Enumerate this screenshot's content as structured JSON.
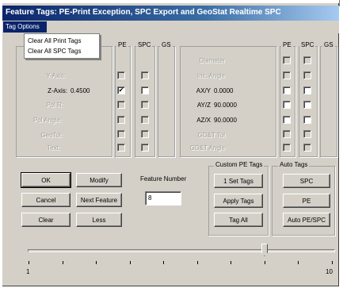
{
  "window": {
    "title": "Feature Tags: PE-Print Exception, SPC Export and GeoStat Realtime SPC"
  },
  "menu": {
    "tag_options": "Tag Options",
    "items": [
      "Clear All Print Tags",
      "Clear All SPC Tags"
    ]
  },
  "group_headers": {
    "pe": "PE",
    "spc": "SPC",
    "gs": "GS"
  },
  "left_fields": [
    {
      "label": "Y-Axis:",
      "value": "",
      "enabled": false,
      "pe": false,
      "spc": false
    },
    {
      "label": "Z-Axis:",
      "value": "0.4500",
      "enabled": true,
      "pe": true,
      "spc": false
    },
    {
      "label": "Pol R:",
      "value": "",
      "enabled": false,
      "pe": false,
      "spc": false
    },
    {
      "label": "Pol Angle:",
      "value": "",
      "enabled": false,
      "pe": false,
      "spc": false
    },
    {
      "label": "GeoTol:",
      "value": "",
      "enabled": false,
      "pe": false,
      "spc": false
    },
    {
      "label": "Text:",
      "value": "",
      "enabled": false,
      "pe": false,
      "spc": false
    }
  ],
  "right_fields": [
    {
      "label": "Diameter",
      "value": "",
      "enabled": false
    },
    {
      "label": "Inc. Angle",
      "value": "",
      "enabled": false
    },
    {
      "label": "AX/Y",
      "value": "0.0000",
      "enabled": true
    },
    {
      "label": "AY/Z",
      "value": "90.0000",
      "enabled": true
    },
    {
      "label": "AZ/X",
      "value": "90.0000",
      "enabled": true
    },
    {
      "label": "GD&T Tol",
      "value": "",
      "enabled": false
    },
    {
      "label": "GD&T Angle",
      "value": "",
      "enabled": false
    }
  ],
  "buttons": {
    "ok": "OK",
    "modify": "Modify",
    "cancel": "Cancel",
    "next_feature": "Next Feature",
    "clear": "Clear",
    "less": "Less"
  },
  "feature_number": {
    "label": "Feature Number",
    "value": "8"
  },
  "custom_pe_tags": {
    "title": "Custom PE Tags",
    "set_tags": "1 Set Tags",
    "apply_tags": "Apply Tags",
    "tag_all": "Tag All"
  },
  "auto_tags": {
    "title": "Auto Tags",
    "spc": "SPC",
    "pe": "PE",
    "auto_pe_spc": "Auto PE/SPC"
  },
  "slider": {
    "min": "1",
    "max": "10",
    "value": 8
  },
  "icons": {
    "checkmark": "check-icon"
  }
}
